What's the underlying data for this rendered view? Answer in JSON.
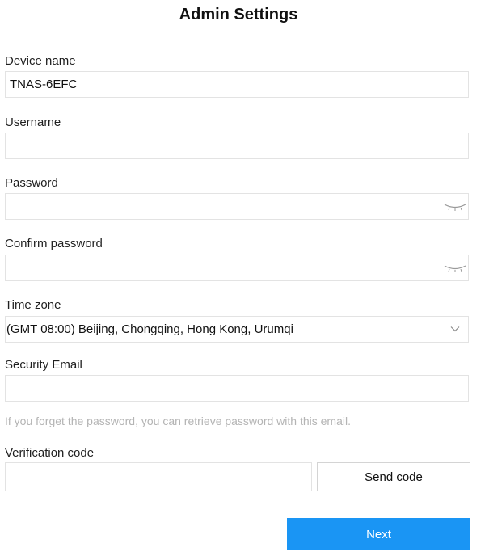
{
  "page": {
    "title": "Admin Settings"
  },
  "device_name": {
    "label": "Device name",
    "value": "TNAS-6EFC"
  },
  "username": {
    "label": "Username",
    "value": "",
    "placeholder": ""
  },
  "password": {
    "label": "Password",
    "value": "",
    "toggle_icon": "eye-closed-icon"
  },
  "confirm_password": {
    "label": "Confirm password",
    "value": "",
    "toggle_icon": "eye-closed-icon"
  },
  "time_zone": {
    "label": "Time zone",
    "selected": "(GMT 08:00) Beijing, Chongqing, Hong Kong, Urumqi",
    "icon": "chevron-down-icon"
  },
  "security_email": {
    "label": "Security Email",
    "value": "",
    "hint": "If you forget the password, you can retrieve password with this email."
  },
  "verification_code": {
    "label": "Verification code",
    "value": "",
    "send_label": "Send code"
  },
  "actions": {
    "next_label": "Next"
  },
  "colors": {
    "primary": "#1a95f4",
    "border": "#e3e3e3",
    "hint_text": "#b4b4b4"
  }
}
